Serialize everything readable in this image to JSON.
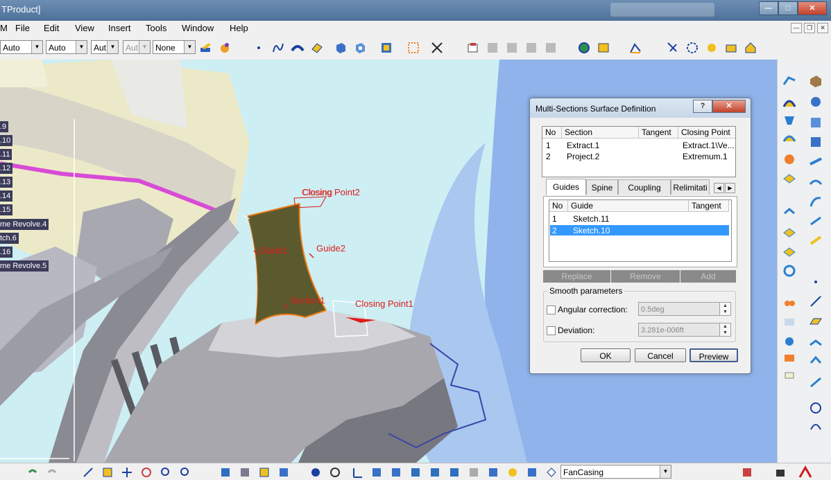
{
  "window": {
    "title": "TProduct]",
    "buttons": {
      "minimize": "—",
      "restore": "□",
      "close": "✕"
    }
  },
  "menu": {
    "app_letter": "M",
    "items": [
      "File",
      "Edit",
      "View",
      "Insert",
      "Tools",
      "Window",
      "Help"
    ],
    "mdi_buttons": [
      "—",
      "❐",
      "✕"
    ]
  },
  "toolbar": {
    "combo1": "Auto",
    "combo2": "Auto",
    "combo3": "Aut",
    "combo4": "Aut",
    "combo5": "None"
  },
  "tree": {
    "items": [
      ".9",
      ".10",
      ".11",
      ".12",
      ".13",
      ".14",
      ".15",
      "me Revolve.4",
      "tch.6",
      ".16",
      "me Revolve.5"
    ]
  },
  "viewport_labels": {
    "closing_point2": "Closing Point2",
    "closing_overlap": "Closing",
    "guide1": "Guide1",
    "guide2": "Guide2",
    "section1": "Section1",
    "closing_point1": "Closing Point1"
  },
  "dialog": {
    "title": "Multi-Sections Surface Definition",
    "help_button": "?",
    "close_button": "✕",
    "sections": {
      "headers": [
        "No",
        "Section",
        "Tangent",
        "Closing Point"
      ],
      "rows": [
        {
          "no": "1",
          "section": "Extract.1",
          "tangent": "",
          "closing": "Extract.1\\Ve..."
        },
        {
          "no": "2",
          "section": "Project.2",
          "tangent": "",
          "closing": "Extremum.1"
        }
      ]
    },
    "tabs": [
      "Guides",
      "Spine",
      "Coupling",
      "Relimitati"
    ],
    "guides": {
      "headers": [
        "No",
        "Guide",
        "Tangent"
      ],
      "rows": [
        {
          "no": "1",
          "guide": "Sketch.11",
          "tangent": "",
          "selected": false
        },
        {
          "no": "2",
          "guide": "Sketch.10",
          "tangent": "",
          "selected": true
        }
      ]
    },
    "guide_buttons": [
      "Replace",
      "Remove",
      "Add"
    ],
    "smooth": {
      "legend": "Smooth parameters",
      "angular_label": "Angular correction:",
      "angular_value": "0.5deg",
      "deviation_label": "Deviation:",
      "deviation_value": "3.281e-006ft"
    },
    "buttons": {
      "ok": "OK",
      "cancel": "Cancel",
      "preview": "Preview"
    }
  },
  "bottom": {
    "combo": "FanCasing"
  },
  "colors": {
    "accent_selection": "#3399ff",
    "label_red": "#e01b1b",
    "surface_olive": "#5b5a2e",
    "edge_orange": "#f07a10"
  }
}
